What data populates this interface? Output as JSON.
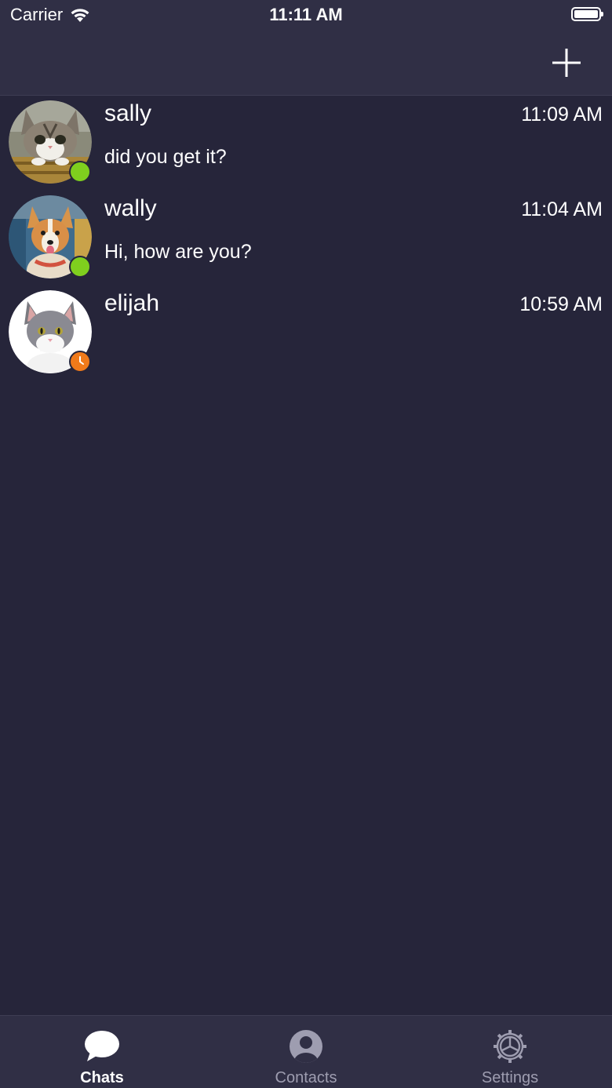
{
  "status_bar": {
    "carrier": "Carrier",
    "time": "11:11 AM"
  },
  "nav": {
    "add_icon": "plus-icon"
  },
  "chats": [
    {
      "name": "sally",
      "time": "11:09 AM",
      "preview": "did you get it?",
      "status": "online",
      "avatar": "tabby-cat"
    },
    {
      "name": "wally",
      "time": "11:04 AM",
      "preview": "Hi, how are you?",
      "status": "online",
      "avatar": "corgi-dog"
    },
    {
      "name": "elijah",
      "time": "10:59 AM",
      "preview": "",
      "status": "away",
      "avatar": "gray-white-kitten"
    }
  ],
  "tabs": [
    {
      "label": "Chats",
      "icon": "chat-bubble-icon",
      "active": true
    },
    {
      "label": "Contacts",
      "icon": "person-circle-icon",
      "active": false
    },
    {
      "label": "Settings",
      "icon": "gear-icon",
      "active": false
    }
  ],
  "colors": {
    "background": "#26253a",
    "bar": "#302f45",
    "online": "#7fcf1e",
    "away": "#f07a1a",
    "inactive_tab": "#9e9db0"
  }
}
